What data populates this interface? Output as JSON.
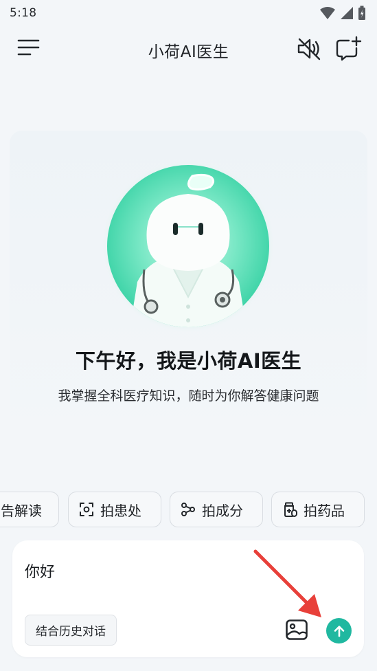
{
  "status_bar": {
    "time": "5:18"
  },
  "header": {
    "title": "小荷AI医生",
    "icons": {
      "menu": "menu-icon",
      "mute": "speaker-muted-icon",
      "new_chat": "new-chat-icon"
    }
  },
  "hero": {
    "greeting": "下午好，我是小荷AI医生",
    "subtitle": "我掌握全科医疗知识，随时为你解答健康问题"
  },
  "quick_actions": [
    {
      "label": "告解读",
      "icon": "report-icon"
    },
    {
      "label": "拍患处",
      "icon": "scan-focus-icon"
    },
    {
      "label": "拍成分",
      "icon": "molecule-icon"
    },
    {
      "label": "拍药品",
      "icon": "medicine-bottle-icon"
    }
  ],
  "composer": {
    "input_value": "你好",
    "history_toggle_label": "结合历史对话",
    "image_icon": "image-icon",
    "send_icon": "arrow-up-icon"
  },
  "colors": {
    "accent": "#20b8a0",
    "annotation_arrow": "#e8403a",
    "background": "#f3f6f9"
  }
}
